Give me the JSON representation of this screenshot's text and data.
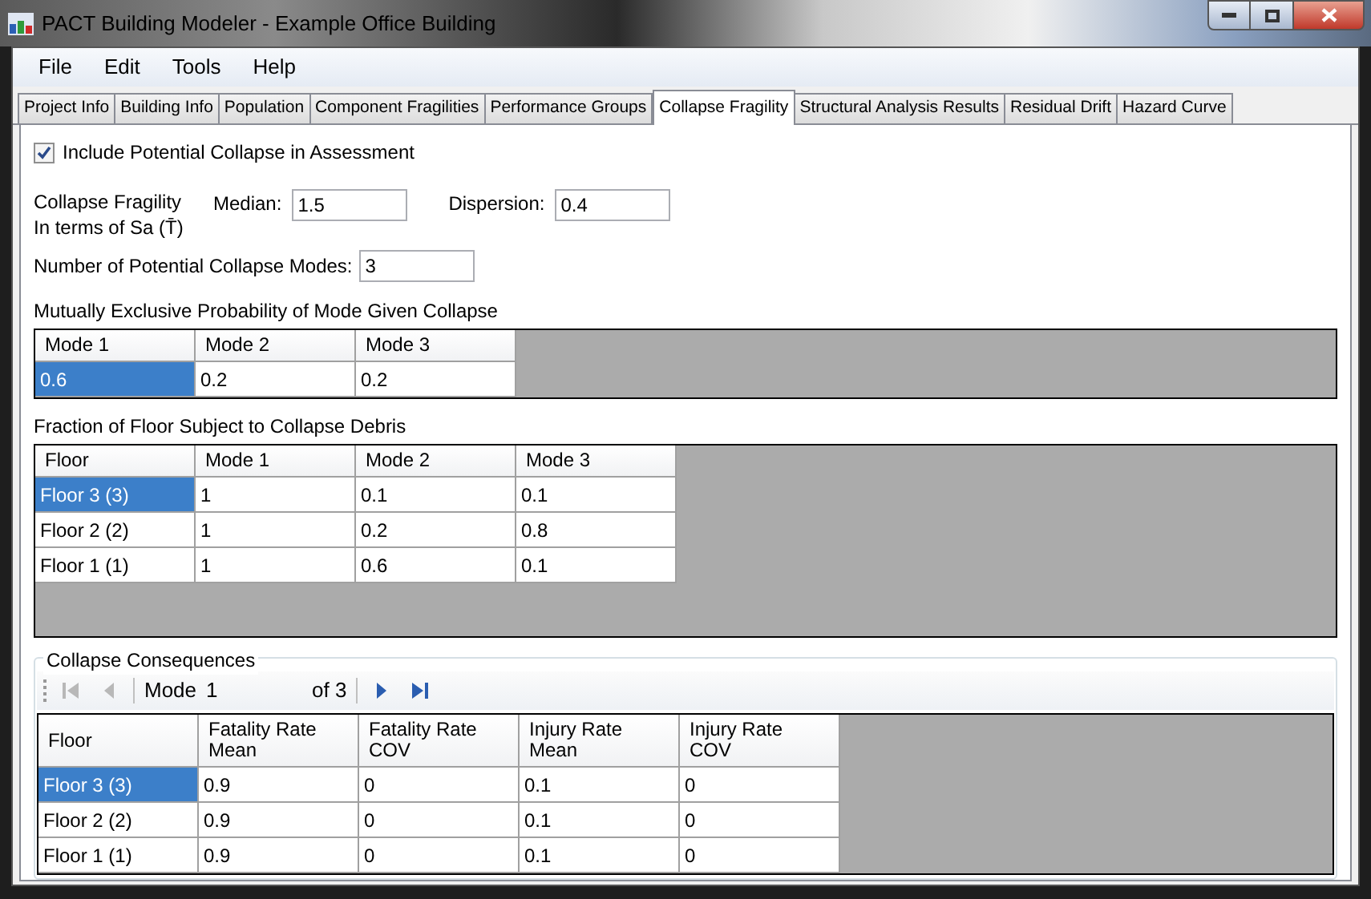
{
  "window": {
    "title": "PACT Building Modeler - Example Office Building"
  },
  "menu": [
    "File",
    "Edit",
    "Tools",
    "Help"
  ],
  "tabs": [
    {
      "label": "Project Info",
      "selected": false
    },
    {
      "label": "Building Info",
      "selected": false
    },
    {
      "label": "Population",
      "selected": false
    },
    {
      "label": "Component Fragilities",
      "selected": false
    },
    {
      "label": "Performance Groups",
      "selected": false
    },
    {
      "label": "Collapse Fragility",
      "selected": true
    },
    {
      "label": "Structural Analysis Results",
      "selected": false
    },
    {
      "label": "Residual Drift",
      "selected": false
    },
    {
      "label": "Hazard Curve",
      "selected": false
    }
  ],
  "include_collapse": {
    "label": "Include Potential Collapse in Assessment",
    "checked": true
  },
  "fragility": {
    "label_line_1": "Collapse Fragility",
    "label_line_2": "In terms of Sa (T̄)",
    "median_label": "Median:",
    "median": "1.5",
    "dispersion_label": "Dispersion:",
    "dispersion": "0.4"
  },
  "modes_count": {
    "label": "Number of Potential Collapse Modes:",
    "value": "3"
  },
  "probability_table": {
    "title": "Mutually Exclusive Probability of Mode Given Collapse",
    "columns": [
      "Mode 1",
      "Mode 2",
      "Mode 3"
    ],
    "rows": [
      {
        "cells": [
          "0.6",
          "0.2",
          "0.2"
        ],
        "selected": true
      }
    ]
  },
  "debris_table": {
    "title": "Fraction of Floor Subject to Collapse Debris",
    "columns": [
      "Floor",
      "Mode 1",
      "Mode 2",
      "Mode 3"
    ],
    "rows": [
      {
        "cells": [
          "Floor 3 (3)",
          "1",
          "0.1",
          "0.1"
        ],
        "selected": true
      },
      {
        "cells": [
          "Floor 2 (2)",
          "1",
          "0.2",
          "0.8"
        ],
        "selected": false
      },
      {
        "cells": [
          "Floor 1 (1)",
          "1",
          "0.6",
          "0.1"
        ],
        "selected": false
      }
    ]
  },
  "consequences": {
    "title": "Collapse Consequences",
    "navigator": {
      "first_disabled": true,
      "prev_disabled": true,
      "label": "Mode",
      "value": "1",
      "total": "of 3",
      "next_disabled": false,
      "last_disabled": false
    },
    "columns": [
      "Floor",
      "Fatality Rate Mean",
      "Fatality Rate COV",
      "Injury Rate Mean",
      "Injury Rate COV"
    ],
    "rows": [
      {
        "cells": [
          "Floor 3 (3)",
          "0.9",
          "0",
          "0.1",
          "0"
        ],
        "selected": true
      },
      {
        "cells": [
          "Floor 2 (2)",
          "0.9",
          "0",
          "0.1",
          "0"
        ],
        "selected": false
      },
      {
        "cells": [
          "Floor 1 (1)",
          "0.9",
          "0",
          "0.1",
          "0"
        ],
        "selected": false
      }
    ]
  }
}
